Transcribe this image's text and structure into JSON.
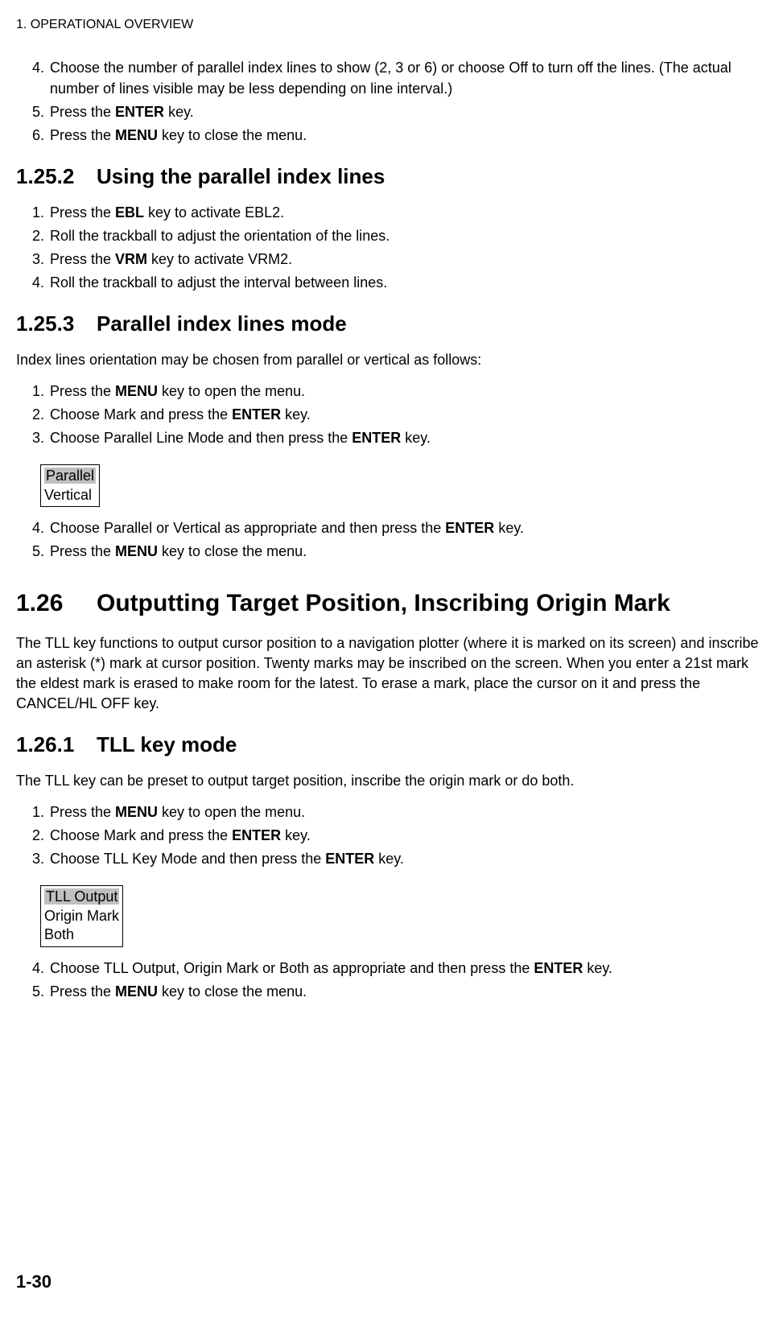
{
  "header": {
    "title": "1. OPERATIONAL OVERVIEW"
  },
  "list1": {
    "items": [
      {
        "num": "4.",
        "text_before": "Choose the number of parallel index lines to show (2, 3 or 6) or choose Off to turn off the lines. (The actual number of lines visible may be less depending on line interval.)"
      },
      {
        "num": "5.",
        "text_before": "Press the ",
        "bold": "ENTER",
        "text_after": " key."
      },
      {
        "num": "6.",
        "text_before": "Press the ",
        "bold": "MENU",
        "text_after": " key to close the menu."
      }
    ]
  },
  "section_1_25_2": {
    "num": "1.25.2",
    "title": "Using the parallel index lines",
    "items": [
      {
        "num": "1.",
        "text_before": "Press the ",
        "bold": "EBL",
        "text_after": " key to activate EBL2."
      },
      {
        "num": "2.",
        "text_before": "Roll the trackball to adjust the orientation of the lines."
      },
      {
        "num": "3.",
        "text_before": "Press the ",
        "bold": "VRM",
        "text_after": " key to activate VRM2."
      },
      {
        "num": "4.",
        "text_before": "Roll the trackball to adjust the interval between lines."
      }
    ]
  },
  "section_1_25_3": {
    "num": "1.25.3",
    "title": "Parallel index lines mode",
    "intro": "Index lines orientation may be chosen from parallel or vertical as follows:",
    "items_a": [
      {
        "num": "1.",
        "text_before": "Press the ",
        "bold": "MENU",
        "text_after": " key to open the menu."
      },
      {
        "num": "2.",
        "text_before": "Choose Mark and press the ",
        "bold": "ENTER",
        "text_after": " key."
      },
      {
        "num": "3.",
        "text_before": "Choose Parallel Line Mode and then press the ",
        "bold": "ENTER",
        "text_after": " key."
      }
    ],
    "option_box": {
      "selected": "Parallel",
      "other": [
        "Vertical"
      ]
    },
    "items_b": [
      {
        "num": "4.",
        "text_before": "Choose Parallel or Vertical as appropriate and then press the ",
        "bold": "ENTER",
        "text_after": " key."
      },
      {
        "num": "5.",
        "text_before": "Press the ",
        "bold": "MENU",
        "text_after": " key to close the menu."
      }
    ]
  },
  "section_1_26": {
    "num": "1.26",
    "title": "Outputting Target Position, Inscribing Origin Mark",
    "intro": "The TLL key functions to output cursor position to a navigation plotter (where it is marked on its screen) and inscribe an asterisk (*) mark at cursor position. Twenty marks may be inscribed on the screen. When you enter a 21st mark the eldest mark is erased to make room for the latest. To erase a mark, place the cursor on it and press the CANCEL/HL OFF key."
  },
  "section_1_26_1": {
    "num": "1.26.1",
    "title": "TLL key mode",
    "intro": "The TLL key can be preset to output target position, inscribe the origin mark or do both.",
    "items_a": [
      {
        "num": "1.",
        "text_before": "Press the ",
        "bold": "MENU",
        "text_after": " key to open the menu."
      },
      {
        "num": "2.",
        "text_before": "Choose Mark and press the ",
        "bold": "ENTER",
        "text_after": " key."
      },
      {
        "num": "3.",
        "text_before": "Choose TLL Key Mode and then press the ",
        "bold": "ENTER",
        "text_after": " key."
      }
    ],
    "option_box": {
      "selected": "TLL Output",
      "other": [
        "Origin Mark",
        "Both"
      ]
    },
    "items_b": [
      {
        "num": "4.",
        "text_before": "Choose TLL Output, Origin Mark or Both as appropriate and then press the ",
        "bold": "ENTER",
        "text_after": " key."
      },
      {
        "num": "5.",
        "text_before": "Press the ",
        "bold": "MENU",
        "text_after": " key to close the menu."
      }
    ]
  },
  "page_number": "1-30"
}
